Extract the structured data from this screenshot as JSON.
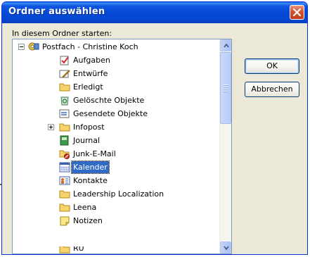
{
  "dialog": {
    "title": "Ordner auswählen",
    "start_label": "In diesem Ordner starten:",
    "ok_label": "OK",
    "cancel_label": "Abbrechen"
  },
  "tree": {
    "root": "Postfach - Christine Koch",
    "items": [
      {
        "label": "Aufgaben",
        "icon": "tasks-icon"
      },
      {
        "label": "Entwürfe",
        "icon": "drafts-icon"
      },
      {
        "label": "Erledigt",
        "icon": "folder-icon"
      },
      {
        "label": "Gelöschte Objekte",
        "icon": "deleted-items-icon"
      },
      {
        "label": "Gesendete Objekte",
        "icon": "sent-items-icon"
      },
      {
        "label": "Infopost",
        "icon": "folder-icon"
      },
      {
        "label": "Journal",
        "icon": "journal-icon"
      },
      {
        "label": "Junk-E-Mail",
        "icon": "junk-mail-icon"
      },
      {
        "label": "Kalender",
        "icon": "calendar-icon",
        "selected": true
      },
      {
        "label": "Kontakte",
        "icon": "contacts-icon"
      },
      {
        "label": "Leadership Localization",
        "icon": "folder-icon"
      },
      {
        "label": "Leena",
        "icon": "folder-icon"
      },
      {
        "label": "Notizen",
        "icon": "notes-icon"
      },
      {
        "label": "RU",
        "icon": "folder-icon"
      }
    ]
  },
  "colors": {
    "titlebar": "#0449d4",
    "selection": "#316ac5",
    "callout_line": "#5d6b1a"
  }
}
